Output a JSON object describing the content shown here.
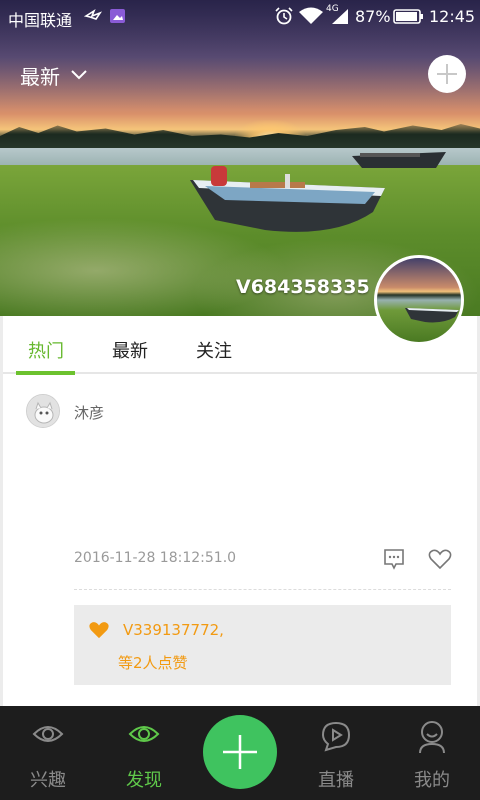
{
  "status_bar": {
    "carrier": "中国联通",
    "network_type": "4G",
    "battery_percent": "87%",
    "time": "12:45",
    "icons": [
      "signal-swirl-icon",
      "gallery-icon",
      "alarm-icon",
      "wifi-icon",
      "cell-signal-icon",
      "battery-icon"
    ]
  },
  "header": {
    "sort_label": "最新",
    "icons": [
      "chevron-down-icon",
      "plus-icon"
    ]
  },
  "profile": {
    "username": "V684358335"
  },
  "tabs": [
    {
      "label": "热门",
      "active": true
    },
    {
      "label": "最新",
      "active": false
    },
    {
      "label": "关注",
      "active": false
    }
  ],
  "post": {
    "author": "沐彦",
    "timestamp": "2016-11-28 18:12:51.0",
    "likes": {
      "liker": "V339137772,",
      "count_text": "等2人点赞"
    },
    "icons": [
      "comment-icon",
      "heart-icon"
    ]
  },
  "bottom_nav": {
    "items": [
      {
        "label": "兴趣",
        "icon": "eye-icon",
        "active": false
      },
      {
        "label": "发现",
        "icon": "eye-icon",
        "active": true
      },
      {
        "label": "直播",
        "icon": "live-chat-icon",
        "active": false
      },
      {
        "label": "我的",
        "icon": "person-icon",
        "active": false
      }
    ],
    "fab_icon": "plus-icon"
  },
  "colors": {
    "accent_green": "#66b82e",
    "fab_green": "#3fc35f",
    "like_orange": "#f29a12",
    "nav_background": "#1d1d1d"
  }
}
